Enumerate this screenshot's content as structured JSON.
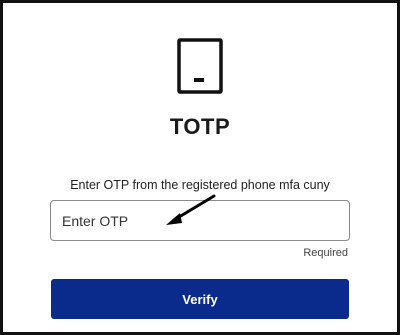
{
  "header": {
    "icon": "phone-icon",
    "title": "TOTP"
  },
  "form": {
    "instruction": "Enter OTP from the registered phone mfa cuny",
    "otp_placeholder": "Enter OTP",
    "otp_value": "",
    "required_label": "Required",
    "verify_label": "Verify"
  },
  "annotation": {
    "icon": "arrow-annotation"
  },
  "colors": {
    "verify_button": "#0a2b8c",
    "border": "#111111"
  }
}
